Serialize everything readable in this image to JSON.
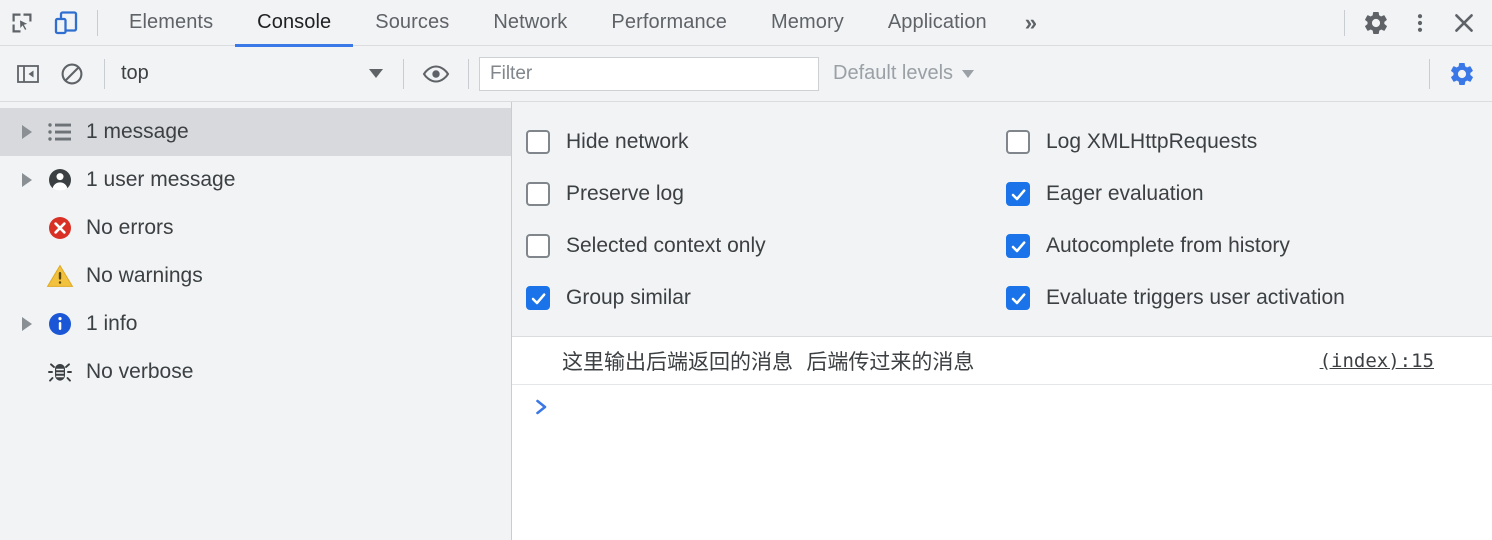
{
  "colors": {
    "accent": "#1a73e8",
    "tab_underline": "#3b78e7",
    "toolbar_bg": "#f1f3f4",
    "panel_bg": "#ffffff",
    "selected_row_bg": "#d7d9dc",
    "error_red": "#d93025",
    "warning_yellow": "#f2c23e",
    "info_blue": "#1a56d6",
    "text": "#3c4043",
    "muted_text": "#9aa0a6"
  },
  "tabbar": {
    "inspect_icon": "inspect-element-icon",
    "device_icon": "device-toolbar-icon",
    "tabs": [
      {
        "label": "Elements",
        "active": false
      },
      {
        "label": "Console",
        "active": true
      },
      {
        "label": "Sources",
        "active": false
      },
      {
        "label": "Network",
        "active": false
      },
      {
        "label": "Performance",
        "active": false
      },
      {
        "label": "Memory",
        "active": false
      },
      {
        "label": "Application",
        "active": false
      }
    ],
    "more_tabs": "»",
    "settings_icon": "gear-icon",
    "menu_icon": "kebab-menu-icon",
    "close_icon": "close-icon"
  },
  "filterbar": {
    "sidebar_toggle_icon": "show-console-sidebar-icon",
    "clear_icon": "clear-console-icon",
    "context": {
      "value": "top",
      "caret": "chevron-down-icon"
    },
    "eye_icon": "create-live-expression-icon",
    "filter": {
      "value": "",
      "placeholder": "Filter"
    },
    "levels": {
      "label": "Default levels",
      "caret": "chevron-down-icon"
    },
    "settings_icon": "console-settings-gear-icon"
  },
  "sidebar": {
    "items": [
      {
        "label": "1 message",
        "icon": "list-icon",
        "expandable": true,
        "selected": true
      },
      {
        "label": "1 user message",
        "icon": "person-icon",
        "expandable": true,
        "selected": false
      },
      {
        "label": "No errors",
        "icon": "error-icon",
        "expandable": false,
        "selected": false
      },
      {
        "label": "No warnings",
        "icon": "warning-icon",
        "expandable": false,
        "selected": false
      },
      {
        "label": "1 info",
        "icon": "info-icon",
        "expandable": true,
        "selected": false
      },
      {
        "label": "No verbose",
        "icon": "bug-icon",
        "expandable": false,
        "selected": false
      }
    ]
  },
  "settings": {
    "left": [
      {
        "label": "Hide network",
        "checked": false
      },
      {
        "label": "Preserve log",
        "checked": false
      },
      {
        "label": "Selected context only",
        "checked": false
      },
      {
        "label": "Group similar",
        "checked": true
      }
    ],
    "right": [
      {
        "label": "Log XMLHttpRequests",
        "checked": false
      },
      {
        "label": "Eager evaluation",
        "checked": true
      },
      {
        "label": "Autocomplete from history",
        "checked": true
      },
      {
        "label": "Evaluate triggers user activation",
        "checked": true
      }
    ]
  },
  "console": {
    "messages": [
      {
        "text": "这里输出后端返回的消息  后端传过来的消息",
        "source": "(index):15"
      }
    ],
    "prompt": {
      "chevron": "❯",
      "value": ""
    }
  }
}
